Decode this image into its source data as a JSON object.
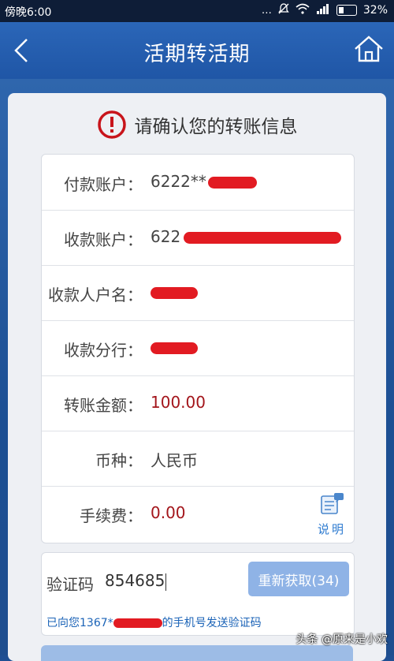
{
  "status_bar": {
    "time": "傍晚6:00",
    "battery": "32%"
  },
  "header": {
    "title": "活期转活期"
  },
  "confirm": {
    "text": "请确认您的转账信息"
  },
  "rows": [
    {
      "label": "付款账户：",
      "value": "6222**",
      "redacted": true
    },
    {
      "label": "收款账户：",
      "value": "622",
      "redacted": true
    },
    {
      "label": "收款人户名：",
      "value": "",
      "redacted": true
    },
    {
      "label": "收款分行：",
      "value": "",
      "redacted": true
    },
    {
      "label": "转账金额：",
      "value": "100.00"
    },
    {
      "label": "币种：",
      "value": "人民币"
    },
    {
      "label": "手续费：",
      "value": "0.00"
    }
  ],
  "explain": {
    "label": "说明"
  },
  "verify": {
    "label": "验证码",
    "code": "854685",
    "resend": "重新获取(34)",
    "notice_prefix": "已向您1367*",
    "notice_suffix": "的手机号发送验证码"
  },
  "watermark": "头条 @原来是小欢",
  "colors": {
    "header": "#2b66b8",
    "amount_red": "#a3151b",
    "link_blue": "#1b63b7",
    "button_disabled": "#8fb3e6"
  }
}
